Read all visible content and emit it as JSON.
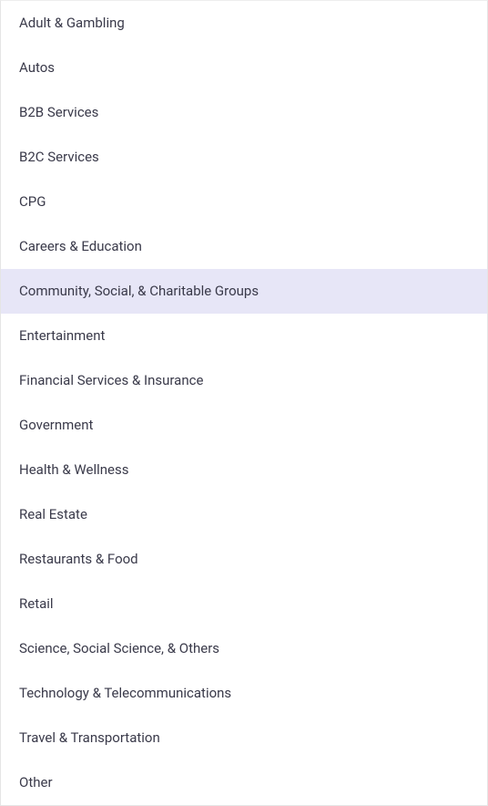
{
  "dropdown": {
    "items": [
      {
        "label": "Adult & Gambling",
        "selected": false
      },
      {
        "label": "Autos",
        "selected": false
      },
      {
        "label": "B2B Services",
        "selected": false
      },
      {
        "label": "B2C Services",
        "selected": false
      },
      {
        "label": "CPG",
        "selected": false
      },
      {
        "label": "Careers & Education",
        "selected": false
      },
      {
        "label": "Community, Social, & Charitable Groups",
        "selected": true
      },
      {
        "label": "Entertainment",
        "selected": false
      },
      {
        "label": "Financial Services & Insurance",
        "selected": false
      },
      {
        "label": "Government",
        "selected": false
      },
      {
        "label": "Health & Wellness",
        "selected": false
      },
      {
        "label": "Real Estate",
        "selected": false
      },
      {
        "label": "Restaurants & Food",
        "selected": false
      },
      {
        "label": "Retail",
        "selected": false
      },
      {
        "label": "Science, Social Science, & Others",
        "selected": false
      },
      {
        "label": "Technology & Telecommunications",
        "selected": false
      },
      {
        "label": "Travel & Transportation",
        "selected": false
      },
      {
        "label": "Other",
        "selected": false
      }
    ]
  }
}
